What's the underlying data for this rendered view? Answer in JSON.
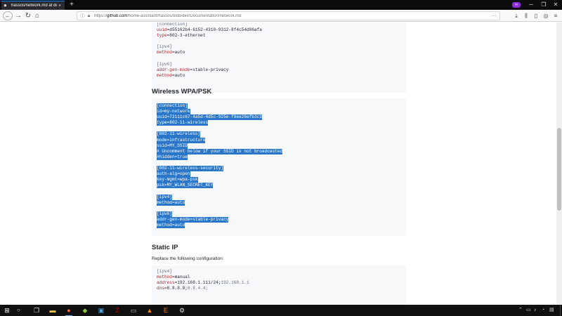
{
  "tab": {
    "title": "hassos/network.md at dev · hom",
    "close": "×",
    "new_tab": "+"
  },
  "window": {
    "minimize": "─",
    "restore": "❐",
    "close": "✕",
    "mask": "∞"
  },
  "nav": {
    "back": "←",
    "forward": "→",
    "reload": "↻",
    "home": "⌂",
    "url_scheme": "https://",
    "url_host": "github.com",
    "url_path": "/home-assistant/hassos/blob/dev/Documentation/network.md",
    "url_more": "···"
  },
  "code_blocks": {
    "top_partial": [
      [
        {
          "t": "[connection]",
          "c": "sec"
        }
      ],
      [
        {
          "t": "uuid",
          "c": "key"
        },
        {
          "t": "=d55162b4-6152-4310-9312-8f4c54d86afa"
        }
      ],
      [
        {
          "t": "type",
          "c": "key"
        },
        {
          "t": "=802-3-ethernet"
        }
      ],
      [],
      [
        {
          "t": "[ipv4]",
          "c": "sec"
        }
      ],
      [
        {
          "t": "method",
          "c": "key"
        },
        {
          "t": "=auto"
        }
      ],
      [],
      [
        {
          "t": "[ipv6]",
          "c": "sec"
        }
      ],
      [
        {
          "t": "addr-gen-mode",
          "c": "key"
        },
        {
          "t": "=stable-privacy"
        }
      ],
      [
        {
          "t": "method",
          "c": "key"
        },
        {
          "t": "=auto"
        }
      ]
    ],
    "wpa_psk": [
      [
        {
          "t": "[connection]",
          "c": "sel"
        }
      ],
      [
        {
          "t": "id=my-network",
          "c": "sel"
        }
      ],
      [
        {
          "t": "uuid=72111c67-4a5d-4d5c-925e-f8ee26efb3c3",
          "c": "sel"
        }
      ],
      [
        {
          "t": "type=802-11-wireless",
          "c": "sel"
        }
      ],
      [],
      [
        {
          "t": "[802-11-wireless]",
          "c": "sel"
        }
      ],
      [
        {
          "t": "mode=infrastructure",
          "c": "sel"
        }
      ],
      [
        {
          "t": "ssid=MY_SSID",
          "c": "sel"
        }
      ],
      [
        {
          "t": "# Uncomment below if your SSID is not broadcasted",
          "c": "sel"
        }
      ],
      [
        {
          "t": "#hidden=true",
          "c": "sel"
        }
      ],
      [],
      [
        {
          "t": "[802-11-wireless-security]",
          "c": "sel"
        }
      ],
      [
        {
          "t": "auth-alg=open",
          "c": "sel"
        }
      ],
      [
        {
          "t": "key-mgmt=wpa-psk",
          "c": "sel"
        }
      ],
      [
        {
          "t": "psk=MY_WLAN_SECRET_KEY",
          "c": "sel"
        }
      ],
      [],
      [
        {
          "t": "[ipv4]",
          "c": "sel"
        }
      ],
      [
        {
          "t": "method=auto",
          "c": "sel"
        }
      ],
      [],
      [
        {
          "t": "[ipv6]",
          "c": "sel"
        }
      ],
      [
        {
          "t": "addr-gen-mode=stable-privacy",
          "c": "sel"
        }
      ],
      [
        {
          "t": "method=auto",
          "c": "sel"
        }
      ]
    ],
    "static_ip": [
      [
        {
          "t": "[ipv4]",
          "c": "sec"
        }
      ],
      [
        {
          "t": "method",
          "c": "key"
        },
        {
          "t": "=manual"
        }
      ],
      [
        {
          "t": "address",
          "c": "key"
        },
        {
          "t": "=192.168.1.111/24;"
        },
        {
          "t": "192.168.1.1",
          "c": "dim"
        }
      ],
      [
        {
          "t": "dns",
          "c": "key"
        },
        {
          "t": "=8.8.8.8;"
        },
        {
          "t": "8.8.4.4;",
          "c": "dim"
        }
      ]
    ]
  },
  "headings": {
    "wpa": "Wireless WPA/PSK",
    "static": "Static IP"
  },
  "paragraphs": {
    "replace": "Replace the following configuration:"
  },
  "taskbar": {
    "start": "⊞",
    "search": "○",
    "apps": [
      {
        "name": "task-view-icon",
        "glyph": "❐",
        "color": "#dddddd"
      },
      {
        "name": "file-explorer-icon",
        "glyph": "▬",
        "color": "#f2c94c"
      },
      {
        "name": "firefox-icon",
        "glyph": "●",
        "color": "#ff7139"
      },
      {
        "name": "cube-app-icon",
        "glyph": "◆",
        "color": "#8bc34a"
      },
      {
        "name": "store-icon",
        "glyph": "▣",
        "color": "#4fa3e0"
      },
      {
        "name": "filezilla-icon",
        "glyph": "Z",
        "color": "#bf0000"
      },
      {
        "name": "terminal-icon",
        "glyph": "▭",
        "color": "#cccccc"
      },
      {
        "name": "vlc-icon",
        "glyph": "▲",
        "color": "#ff8800"
      },
      {
        "name": "editor-icon",
        "glyph": "E",
        "color": "#f07a2a"
      },
      {
        "name": "settings-icon",
        "glyph": "⚙",
        "color": "#dddddd"
      }
    ],
    "tray": [
      "⌃",
      "▭",
      "♪",
      "◔",
      "▤"
    ]
  }
}
